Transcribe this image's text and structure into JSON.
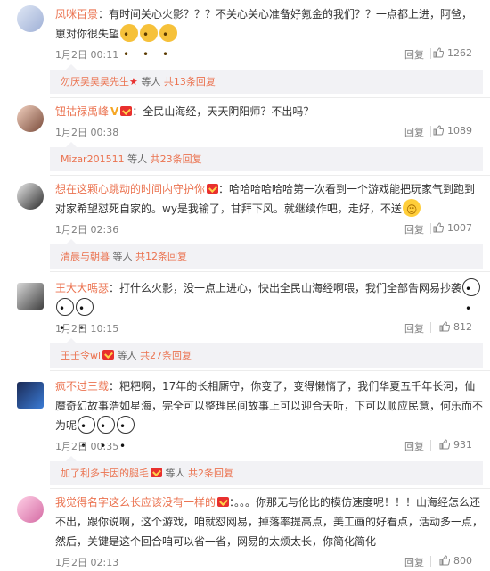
{
  "reply_label": "回复",
  "comments": [
    {
      "username": "凤咪百景",
      "text": "有时间关心火影？？？不关心关心准备好氪金的我们？？一点都上进，阿爸，崽对你很失望",
      "time": "1月2日 00:11",
      "likes": "1262",
      "sub": {
        "names": "勿厌吴昊昊先生",
        "mid": "等人",
        "count": "共13条回复"
      }
    },
    {
      "username": "钮祜禄禹峰",
      "text": "全民山海经，天天阴阳师？不出吗？",
      "time": "1月2日 00:38",
      "likes": "1089",
      "sub": {
        "names": "Mizar201511",
        "mid": "等人",
        "count": "共23条回复"
      }
    },
    {
      "username": "想在这颗心跳动的时间内守护你",
      "text": "哈哈哈哈哈哈第一次看到一个游戏能把玩家气到跑到对家希望怼死自家的。wy是我输了，甘拜下风。就继续作吧，走好，不送",
      "time": "1月2日 02:36",
      "likes": "1007",
      "sub": {
        "names": "清晨与朝暮",
        "mid": "等人",
        "count": "共12条回复"
      }
    },
    {
      "username": "王大大嗎瑟",
      "text": "打什么火影，没一点上进心，快出全民山海经啊喂，我们全部告网易抄袭",
      "time": "1月2日 10:15",
      "likes": "812",
      "sub": {
        "names": "王壬令wl",
        "mid": "等人",
        "count": "共27条回复"
      }
    },
    {
      "username": "疯不过三载",
      "text": "粑粑啊，17年的长相厮守，你变了，变得懒惰了，我们华夏五千年长河，仙魔奇幻故事浩如星海，完全可以整理民间故事上可以迎合天听，下可以顺应民意，何乐而不为呢",
      "time": "1月2日 00:35",
      "likes": "931",
      "sub": {
        "names": "加了利多卡因的腿毛",
        "mid": "等人",
        "count": "共2条回复"
      }
    },
    {
      "username": "我觉得名字这么长应该没有一样的",
      "text": "。。。你那无与伦比的模仿速度呢！！！山海经怎么还不出，跟你说啊，这个游戏，咱就怼网易，掉落率提高点，美工画的好看点，活动多一点，然后，关键是这个回合咱可以省一省，网易的太烦太长，你简化简化",
      "time": "1月2日 02:13",
      "likes": "800"
    }
  ]
}
